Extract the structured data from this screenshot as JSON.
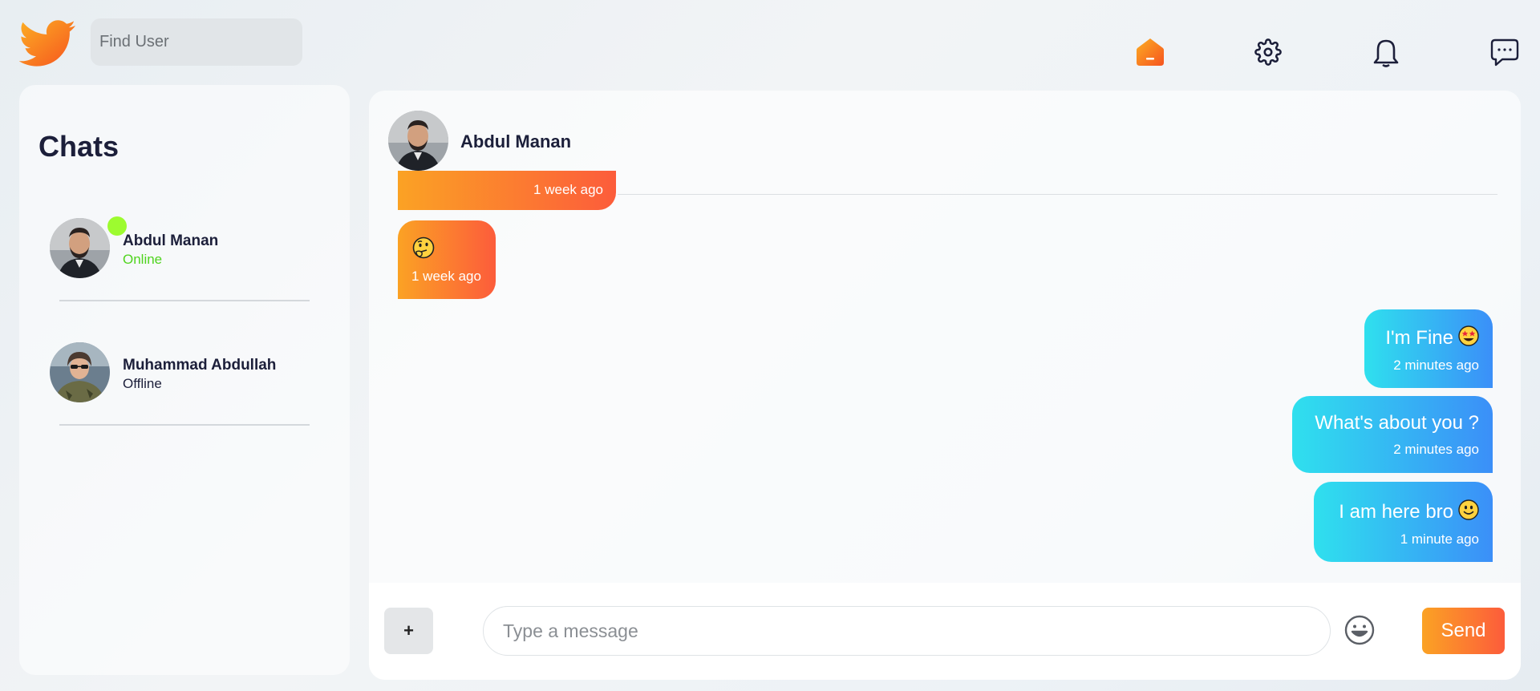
{
  "search": {
    "placeholder": "Find User"
  },
  "nav": {
    "icons": [
      "home-icon",
      "settings-icon",
      "bell-icon",
      "chat-icon"
    ],
    "active_color": "#fb7b2e"
  },
  "sidebar": {
    "title": "Chats",
    "contacts": [
      {
        "name": "Abdul Manan",
        "status": "Online"
      },
      {
        "name": "Muhammad Abdullah",
        "status": "Offline"
      }
    ]
  },
  "chat": {
    "header_name": "Abdul Manan",
    "messages": [
      {
        "direction": "in",
        "text": "",
        "time": "1 week ago"
      },
      {
        "direction": "in",
        "text": "",
        "emoji": "thinking-face",
        "time": "1 week ago"
      },
      {
        "direction": "out",
        "text": "I'm Fine",
        "emoji": "star-struck",
        "time": "2 minutes ago"
      },
      {
        "direction": "out",
        "text": "What's about you ?",
        "time": "2 minutes ago"
      },
      {
        "direction": "out",
        "text": "I am here bro",
        "emoji": "slightly-smiling-face",
        "time": "1 minute ago"
      }
    ]
  },
  "composer": {
    "attach_label": "+",
    "placeholder": "Type a message",
    "send_label": "Send"
  },
  "colors": {
    "incoming_gradient": [
      "#fba224",
      "#fc5c3b"
    ],
    "outgoing_gradient": [
      "#2fe0ee",
      "#3b8ff8"
    ],
    "online": "#4fd41e",
    "online_dot": "#9dfb2f"
  }
}
